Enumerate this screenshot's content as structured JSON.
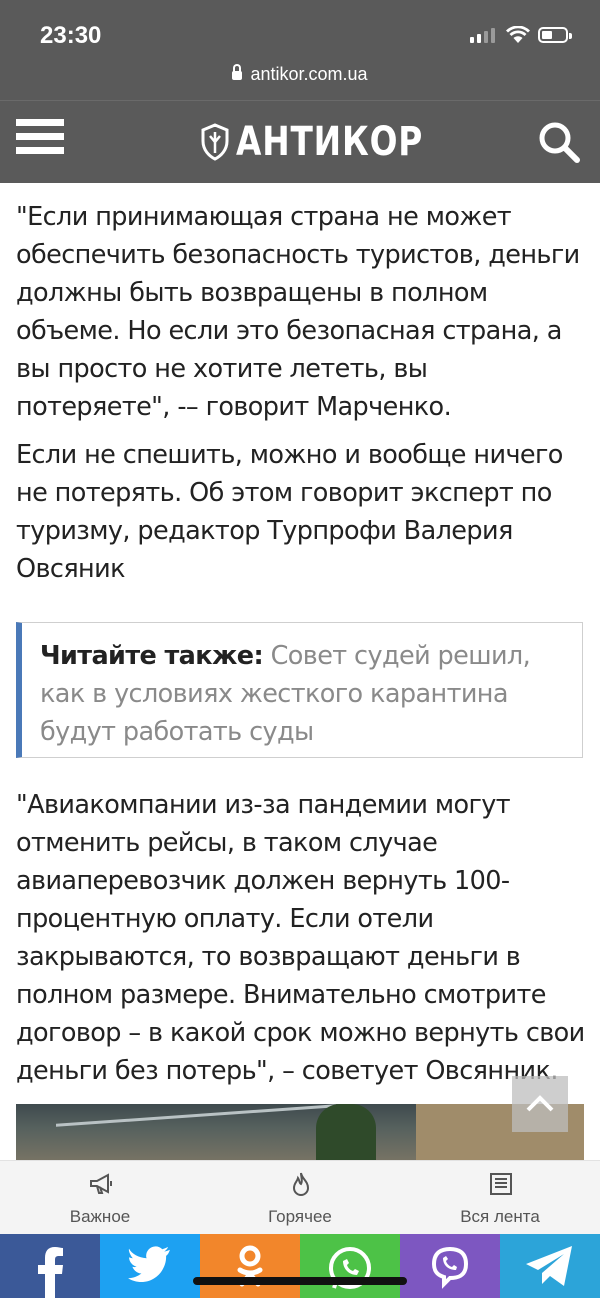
{
  "status": {
    "time": "23:30",
    "url": "antikor.com.ua"
  },
  "header": {
    "logo": "АНТИКОР"
  },
  "article": {
    "p1": "\"Если принимающая страна не может обеспечить безопасность туристов, деньги должны быть возвращены в полном объеме. Но если это безопасная страна, а вы просто не хотите лететь, вы потеряете\", -– говорит Марченко.",
    "p2": "Если не спешить, можно и вообще ничего не потерять. Об этом говорит эксперт по туризму, редактор Турпрофи Валерия Овсяник",
    "read_also_label": "Читайте также:",
    "read_also_link": "Совет судей решил, как в условиях жесткого карантина будут работать суды",
    "p3": "\"Авиакомпании из-за пандемии могут отменить рейсы, в таком случае авиаперевозчик должен вернуть 100-процентную оплату. Если отели закрываются, то возвращают деньги в полном размере. Внимательно смотрите договор – в какой срок можно вернуть свои деньги без потерь\", – советует Овсянник."
  },
  "bottom_nav": {
    "important": "Важное",
    "hot": "Горячее",
    "feed": "Вся лента"
  },
  "share": [
    "facebook-icon",
    "twitter-icon",
    "odnoklassniki-icon",
    "whatsapp-icon",
    "viber-icon",
    "telegram-icon"
  ]
}
